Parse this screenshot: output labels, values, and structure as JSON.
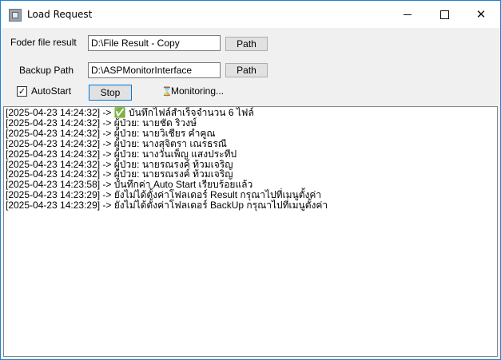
{
  "window": {
    "title": "Load Request"
  },
  "form": {
    "result_folder_label": "Foder file result",
    "result_folder_value": "D:\\File Result - Copy",
    "result_path_button": "Path",
    "backup_path_label": "Backup Path",
    "backup_path_value": "D:\\ASPMonitorInterface",
    "backup_path_button": "Path",
    "autostart_label": "AutoStart",
    "autostart_checked": true,
    "stop_button": "Stop",
    "status_text": "Monitoring..."
  },
  "log": [
    "[2025-04-23 14:24:32] -> ✅ บันทึกไฟล์สำเร็จจำนวน 6 ไฟล์",
    "[2025-04-23 14:24:32] -> ผู้ป่วย: นายชัด ริวงษ์",
    "[2025-04-23 14:24:32] -> ผู้ป่วย: นายวิเชียร คำคูณ",
    "[2025-04-23 14:24:32] -> ผู้ป่วย: นางสุจิตรา เณรธรณี",
    "[2025-04-23 14:24:32] -> ผู้ป่วย: นางวันเพ็ญ แสงประทีป",
    "[2025-04-23 14:24:32] -> ผู้ป่วย: นายรณรงค์ ท้วมเจริญ",
    "[2025-04-23 14:24:32] -> ผู้ป่วย: นายรณรงค์ ท้วมเจริญ",
    "[2025-04-23 14:23:58] -> บันทึกค่า Auto Start เรียบร้อยแล้ว",
    "[2025-04-23 14:23:29] -> ยังไม่ได้ตั้งค่าโฟลเดอร์ Result กรุณาไปที่เมนูตั้งค่า",
    "[2025-04-23 14:23:29] -> ยังไม่ได้ตั้งค่าโฟลเดอร์ BackUp กรุณาไปที่เมนูตั้งค่า"
  ]
}
